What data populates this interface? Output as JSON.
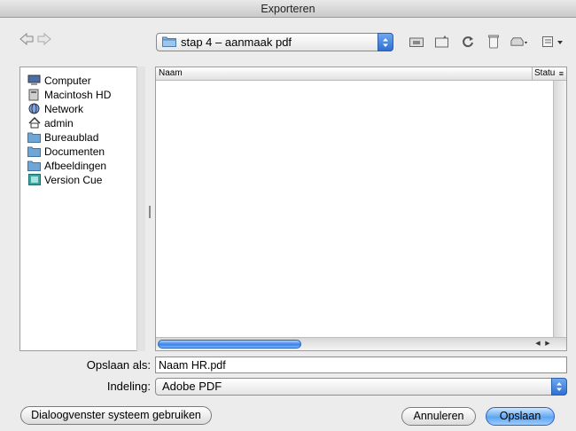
{
  "window": {
    "title": "Exporteren"
  },
  "toolbar": {
    "back_icon": "back-arrow-icon",
    "forward_icon": "forward-arrow-icon",
    "location": "stap 4 – aanmaak pdf",
    "icons": [
      "new-folder-icon",
      "folder-info-icon",
      "refresh-icon",
      "trash-icon",
      "drive-icon",
      "list-view-icon"
    ]
  },
  "sidebar": {
    "items": [
      {
        "label": "Computer",
        "icon": "computer-icon"
      },
      {
        "label": "Macintosh HD",
        "icon": "harddisk-icon"
      },
      {
        "label": "Network",
        "icon": "network-icon"
      },
      {
        "label": "admin",
        "icon": "home-icon"
      },
      {
        "label": "Bureaublad",
        "icon": "folder-icon"
      },
      {
        "label": "Documenten",
        "icon": "folder-icon"
      },
      {
        "label": "Afbeeldingen",
        "icon": "folder-icon"
      },
      {
        "label": "Version Cue",
        "icon": "version-cue-icon"
      }
    ]
  },
  "filelist": {
    "columns": [
      "Naam",
      "Statu"
    ]
  },
  "form": {
    "save_as_label": "Opslaan als:",
    "save_as_value": "Naam HR.pdf",
    "format_label": "Indeling:",
    "format_value": "Adobe PDF"
  },
  "buttons": {
    "system_dialog": "Dialoogvenster systeem gebruiken",
    "cancel": "Annuleren",
    "save": "Opslaan"
  },
  "colors": {
    "accent": "#3b82e6",
    "folder": "#6fa6d6"
  }
}
